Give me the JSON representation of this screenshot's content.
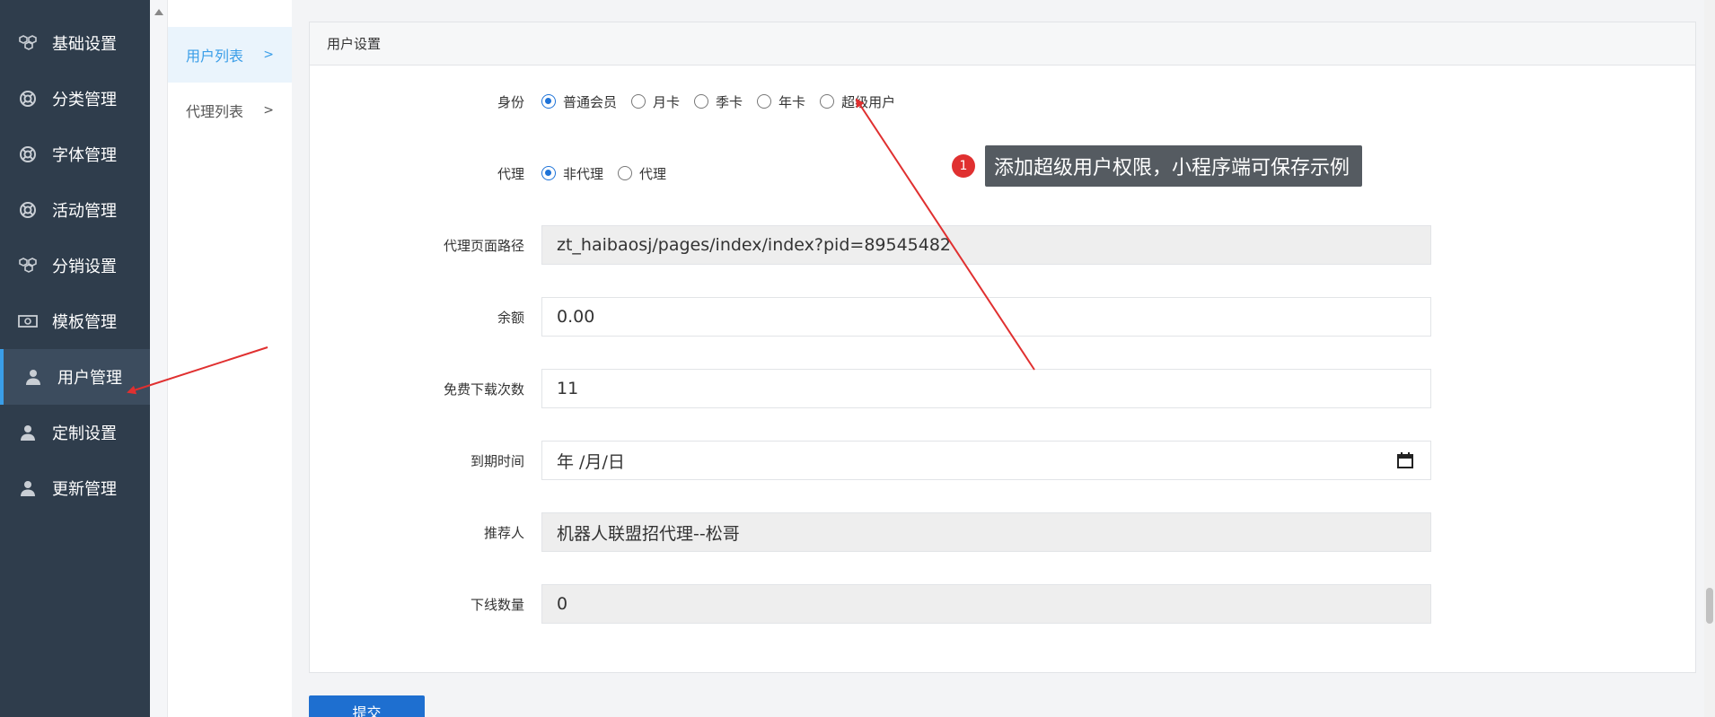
{
  "sidebar": {
    "items": [
      {
        "label": "基础设置",
        "icon": "cubes-icon"
      },
      {
        "label": "分类管理",
        "icon": "lifebuoy-icon"
      },
      {
        "label": "字体管理",
        "icon": "lifebuoy-icon"
      },
      {
        "label": "活动管理",
        "icon": "lifebuoy-icon"
      },
      {
        "label": "分销设置",
        "icon": "cubes-icon"
      },
      {
        "label": "模板管理",
        "icon": "money-icon"
      },
      {
        "label": "用户管理",
        "icon": "user-icon",
        "active": true
      },
      {
        "label": "定制设置",
        "icon": "user-icon"
      },
      {
        "label": "更新管理",
        "icon": "user-icon"
      }
    ]
  },
  "subnav": {
    "items": [
      {
        "label": "用户列表",
        "active": true
      },
      {
        "label": "代理列表"
      }
    ],
    "chevron": ">"
  },
  "panel": {
    "title": "用户设置"
  },
  "form": {
    "identity": {
      "label": "身份",
      "options": [
        "普通会员",
        "月卡",
        "季卡",
        "年卡",
        "超级用户"
      ],
      "selected": "普通会员"
    },
    "agent": {
      "label": "代理",
      "options": [
        "非代理",
        "代理"
      ],
      "selected": "非代理"
    },
    "agent_path": {
      "label": "代理页面路径",
      "value": "zt_haibaosj/pages/index/index?pid=89545482"
    },
    "balance": {
      "label": "余额",
      "value": "0.00"
    },
    "free_downloads": {
      "label": "免费下载次数",
      "value": "11"
    },
    "expire": {
      "label": "到期时间",
      "placeholder": "年 /月/日"
    },
    "referrer": {
      "label": "推荐人",
      "value": "机器人联盟招代理--松哥"
    },
    "downline": {
      "label": "下线数量",
      "value": "0"
    }
  },
  "submit_label": "提交",
  "annotation": {
    "badge": "1",
    "text": "添加超级用户权限，小程序端可保存示例",
    "color": "#e03030"
  },
  "colors": {
    "sidebar_bg": "#2f3d4c",
    "accent": "#3a9ee8",
    "primary_button": "#1e6fd0"
  }
}
